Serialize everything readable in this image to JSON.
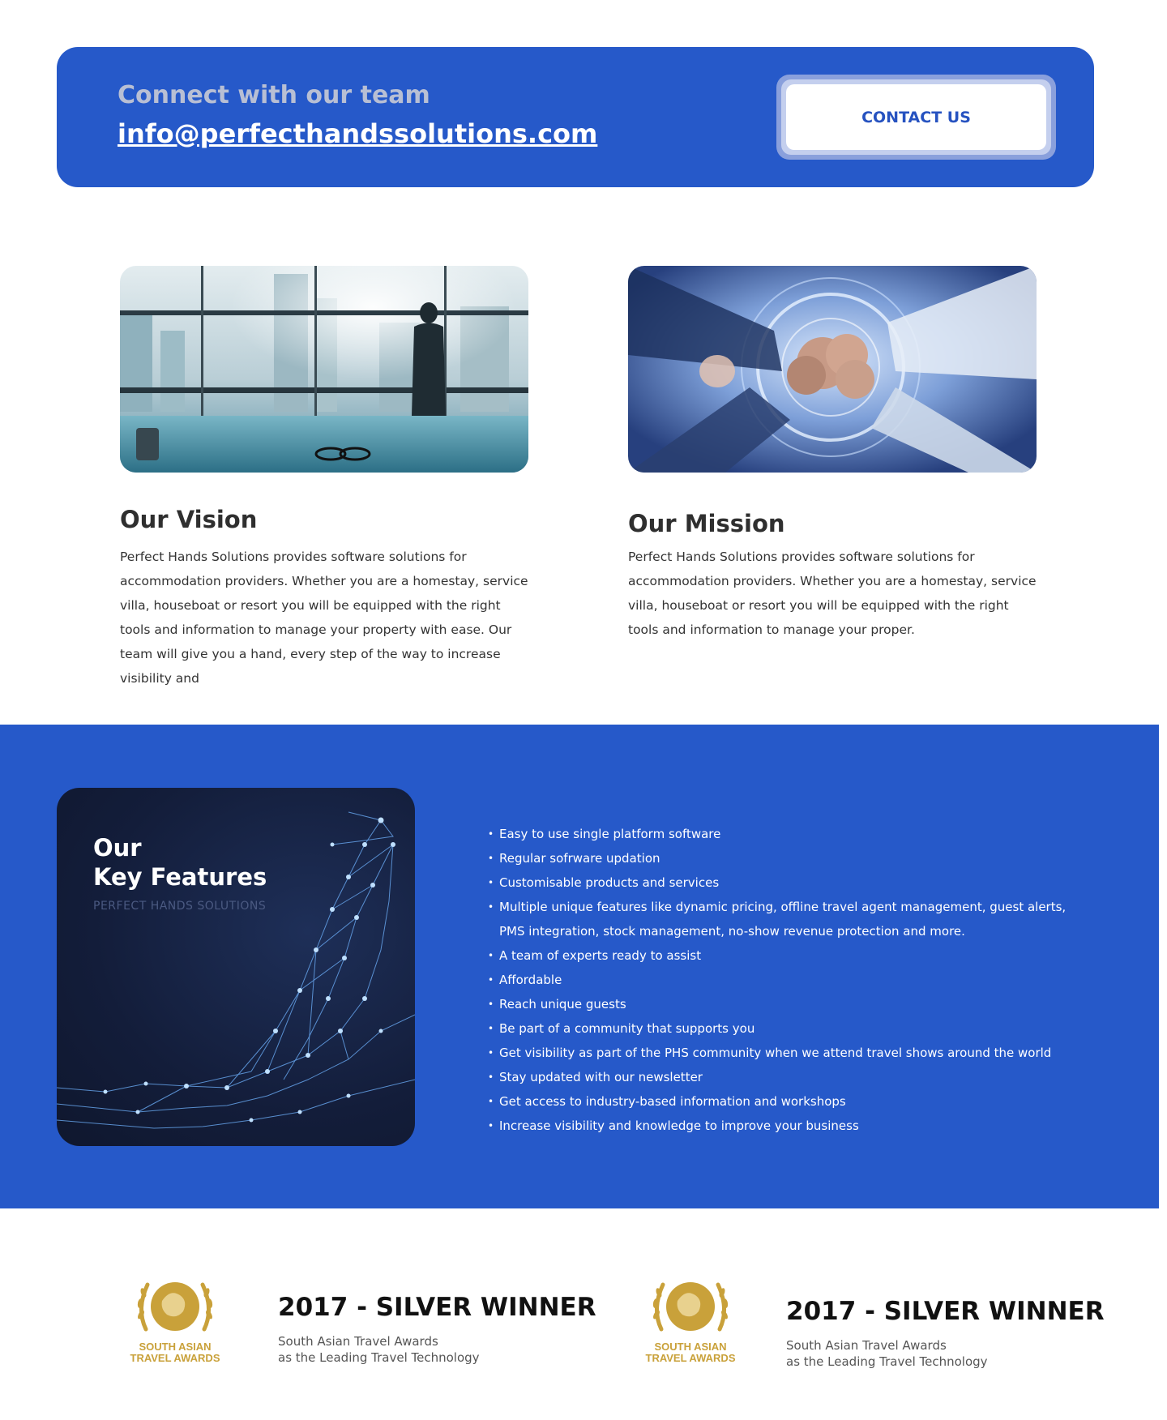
{
  "contact": {
    "kicker": "Connect with our team",
    "email": "info@perfecthandssolutions.com",
    "button_label": "CONTACT US"
  },
  "vision": {
    "title": "Our Vision",
    "body": "Perfect Hands Solutions provides software solutions for accommodation providers. Whether you are a homestay, service villa, houseboat or resort you will be equipped with the right tools and information to manage your property with ease. Our team will give you a hand, every step of the way to increase visibility and"
  },
  "mission": {
    "title": "Our Mission",
    "body": "Perfect Hands Solutions provides software solutions for accommodation providers. Whether you are a homestay, service villa, houseboat or resort you will be equipped with the right tools and information to manage your proper."
  },
  "features": {
    "card_title_line1": "Our",
    "card_title_line2": "Key Features",
    "card_subtitle": "PERFECT HANDS SOLUTIONS",
    "items": [
      "Easy to use single platform software",
      "Regular sofrware updation",
      "Customisable products and services",
      "Multiple unique features like dynamic pricing, offline travel agent management, guest alerts, PMS integration, stock management, no-show revenue protection and more.",
      "A team of experts ready to assist",
      "Affordable",
      "Reach unique guests",
      "Be part of a community that supports you",
      "Get visibility as part of the PHS community when we attend travel shows around the world",
      "Stay updated with our newsletter",
      "Get access to industry-based information and workshops",
      "Increase visibility and knowledge to improve your business"
    ]
  },
  "awards": [
    {
      "logo_text_line1": "SOUTH ASIAN",
      "logo_text_line2": "TRAVEL AWARDS",
      "title": "2017 - SILVER WINNER",
      "desc_line1": "South Asian Travel Awards",
      "desc_line2": "as the Leading Travel Technology"
    },
    {
      "logo_text_line1": "SOUTH ASIAN",
      "logo_text_line2": "TRAVEL AWARDS",
      "title": "2017 - SILVER WINNER",
      "desc_line1": "South Asian Travel Awards",
      "desc_line2": "as the Leading Travel Technology"
    }
  ],
  "colors": {
    "brand_blue": "#2659c9",
    "gold": "#c9a13a"
  }
}
